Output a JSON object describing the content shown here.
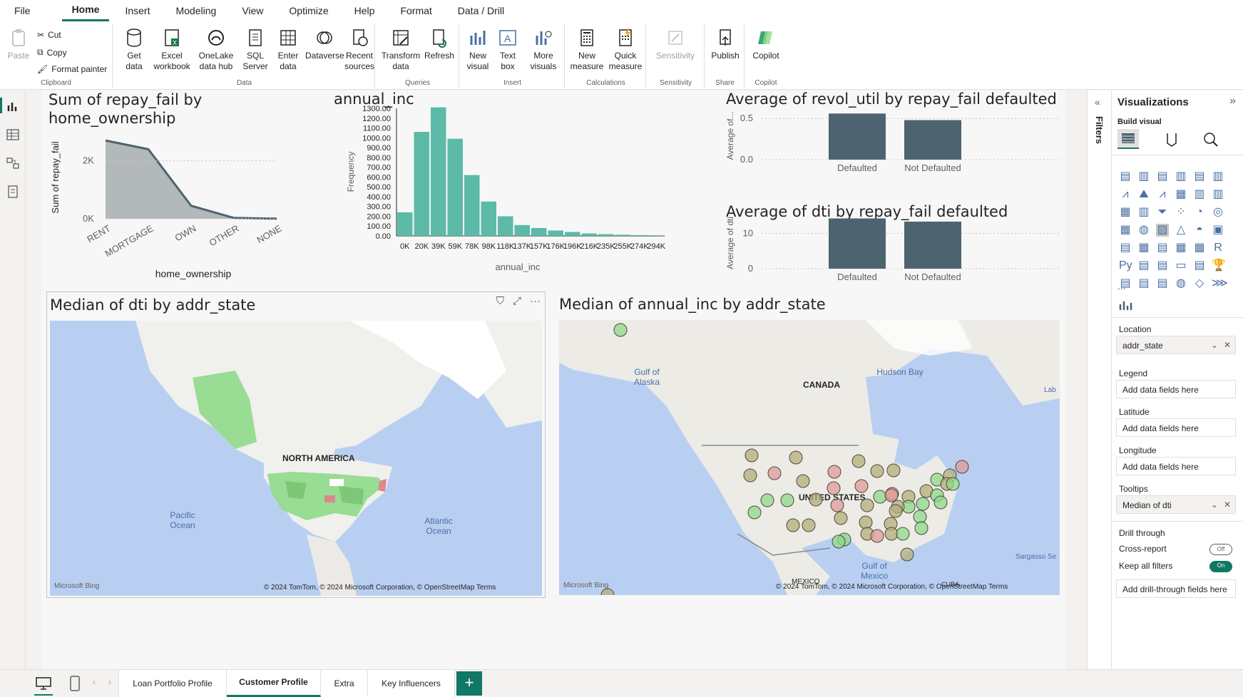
{
  "menu": [
    "File",
    "Home",
    "Insert",
    "Modeling",
    "View",
    "Optimize",
    "Help",
    "Format",
    "Data / Drill"
  ],
  "ribbon": {
    "clipboard": {
      "paste": "Paste",
      "cut": "Cut",
      "copy": "Copy",
      "format_painter": "Format painter",
      "label": "Clipboard"
    },
    "data": {
      "get_data": "Get data",
      "excel": "Excel workbook",
      "onelake": "OneLake data hub",
      "sql": "SQL Server",
      "enter": "Enter data",
      "dataverse": "Dataverse",
      "recent": "Recent sources",
      "label": "Data"
    },
    "queries": {
      "transform": "Transform data",
      "refresh": "Refresh",
      "label": "Queries"
    },
    "insert": {
      "new_visual": "New visual",
      "text_box": "Text box",
      "more_visuals": "More visuals",
      "label": "Insert"
    },
    "calculations": {
      "new_measure": "New measure",
      "quick_measure": "Quick measure",
      "label": "Calculations"
    },
    "sensitivity": {
      "btn": "Sensitivity",
      "label": "Sensitivity"
    },
    "share": {
      "publish": "Publish",
      "label": "Share"
    },
    "copilot": {
      "btn": "Copilot",
      "label": "Copilot"
    }
  },
  "visuals": {
    "area_title": "Sum of repay_fail by home_ownership",
    "hist_title": "annual_inc",
    "revol_title": "Average of revol_util by repay_fail defaulted",
    "dti_title": "Average of dti by repay_fail defaulted",
    "map1_title": "Median of dti by addr_state",
    "map2_title": "Median of annual_inc by addr_state"
  },
  "chart_data": [
    {
      "type": "area",
      "title": "Sum of repay_fail by home_ownership",
      "xlabel": "home_ownership",
      "ylabel": "Sum of repay_fail",
      "categories": [
        "RENT",
        "MORTGAGE",
        "OWN",
        "OTHER",
        "NONE"
      ],
      "values": [
        2700,
        2400,
        450,
        30,
        5
      ],
      "yticks": [
        "2K",
        "0K"
      ],
      "ylim": [
        0,
        2900
      ]
    },
    {
      "type": "bar",
      "title": "annual_inc",
      "xlabel": "annual_inc",
      "ylabel": "Frequency",
      "categories": [
        "0K",
        "20K",
        "39K",
        "59K",
        "78K",
        "98K",
        "118K",
        "137K",
        "157K",
        "176K",
        "196K",
        "216K",
        "235K",
        "255K",
        "274K",
        "294K"
      ],
      "values": [
        240,
        1060,
        1310,
        990,
        620,
        350,
        200,
        110,
        80,
        55,
        40,
        25,
        18,
        12,
        8,
        6
      ],
      "yticks": [
        "1300.00",
        "1200.00",
        "1100.00",
        "1000.00",
        "900.00",
        "800.00",
        "700.00",
        "600.00",
        "500.00",
        "400.00",
        "300.00",
        "200.00",
        "100.00",
        "0.00"
      ],
      "ylim": [
        0,
        1300
      ]
    },
    {
      "type": "bar",
      "title": "Average of revol_util by repay_fail defaulted",
      "ylabel": "Average of...",
      "categories": [
        "Defaulted",
        "Not Defaulted"
      ],
      "values": [
        0.56,
        0.48
      ],
      "yticks": [
        "0.5",
        "0.0"
      ],
      "ylim": [
        0,
        0.58
      ]
    },
    {
      "type": "bar",
      "title": "Average of dti by repay_fail defaulted",
      "ylabel": "Average of dti",
      "categories": [
        "Defaulted",
        "Not Defaulted"
      ],
      "values": [
        14.2,
        13.3
      ],
      "yticks": [
        "10",
        "0"
      ],
      "ylim": [
        0,
        14.5
      ]
    }
  ],
  "map1": {
    "labels": {
      "na": "NORTH AMERICA",
      "pacific": "Pacific Ocean",
      "atlantic": "Atlantic Ocean"
    },
    "copyright": "© 2024 TomTom, © 2024 Microsoft Corporation, © OpenStreetMap  Terms",
    "bing": "Microsoft Bing"
  },
  "map2": {
    "labels": {
      "gulf_alaska": "Gulf of Alaska",
      "canada": "CANADA",
      "hudson": "Hudson Bay",
      "us": "UNITED STATES",
      "gulf_mexico": "Gulf of Mexico",
      "mexico": "MEXICO",
      "sargasso": "Sargasso Se",
      "cuba": "CUBA",
      "lab": "Lab"
    },
    "copyright": "© 2024 TomTom, © 2024 Microsoft Corporation, © OpenStreetMap  Terms",
    "bing": "Microsoft Bing"
  },
  "filters_label": "Filters",
  "viz": {
    "title": "Visualizations",
    "build": "Build visual",
    "location": "Location",
    "location_value": "addr_state",
    "legend": "Legend",
    "legend_ph": "Add data fields here",
    "latitude": "Latitude",
    "latitude_ph": "Add data fields here",
    "longitude": "Longitude",
    "longitude_ph": "Add data fields here",
    "tooltips": "Tooltips",
    "tooltips_value": "Median of dti",
    "drill": "Drill through",
    "cross": "Cross-report",
    "cross_state": "Off",
    "keep": "Keep all filters",
    "keep_state": "On",
    "drill_ph": "Add drill-through fields here",
    "more": "..."
  },
  "tabs": [
    "Loan Portfolio Profile",
    "Customer Profile",
    "Extra",
    "Key Influencers"
  ],
  "tab_add": "+",
  "colors": {
    "accent": "#117865",
    "bar_teal": "#5db9a8",
    "bar_slate": "#4d6470",
    "area": "#b3b8ba",
    "line": "#4d6470",
    "map_green": "#8fd98a",
    "map_red": "#d98a8a",
    "map_olive": "#a8a56d",
    "water": "#b9cff2"
  }
}
